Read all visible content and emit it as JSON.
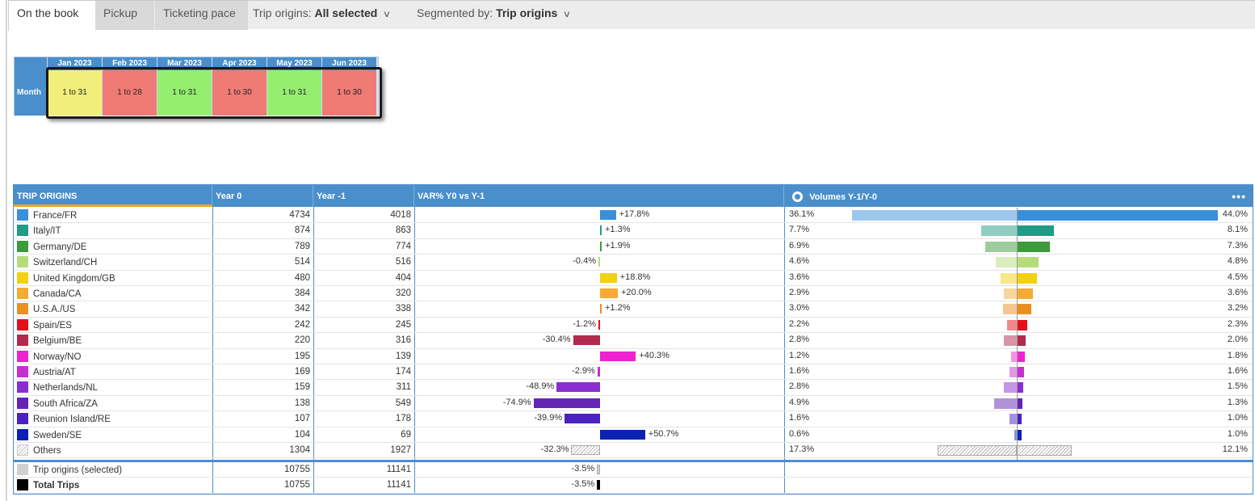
{
  "tabs": [
    "On the book",
    "Pickup",
    "Ticketing pace"
  ],
  "filters": [
    {
      "label": "Trip origins:",
      "value": "All selected"
    },
    {
      "label": "Segmented by:",
      "value": "Trip origins"
    }
  ],
  "calendar": {
    "row_label": "Month",
    "months": [
      {
        "name": "Jan 2023",
        "range": "1 to 31",
        "status": "yellow"
      },
      {
        "name": "Feb 2023",
        "range": "1 to 28",
        "status": "red"
      },
      {
        "name": "Mar 2023",
        "range": "1 to 31",
        "status": "green"
      },
      {
        "name": "Apr 2023",
        "range": "1 to 30",
        "status": "red"
      },
      {
        "name": "May 2023",
        "range": "1 to 31",
        "status": "green"
      },
      {
        "name": "Jun 2023",
        "range": "1 to 30",
        "status": "red"
      }
    ]
  },
  "table": {
    "headers": {
      "origin": "TRIP ORIGINS",
      "year0": "Year 0",
      "year1": "Year -1",
      "var": "VAR% Y0 vs Y-1",
      "volumes": "Volumes Y-1/Y-0",
      "menu": "•••"
    },
    "rows": [
      {
        "name": "France/FR",
        "color": "#3a8fdc",
        "y0": "4734",
        "y1": "4018",
        "var": 17.8,
        "var_label": "+17.8%",
        "vol_prev": 36.1,
        "vol_prev_label": "36.1%",
        "vol_cur": 44.0,
        "vol_cur_label": "44.0%"
      },
      {
        "name": "Italy/IT",
        "color": "#1f9b86",
        "y0": "874",
        "y1": "863",
        "var": 1.3,
        "var_label": "+1.3%",
        "vol_prev": 7.7,
        "vol_prev_label": "7.7%",
        "vol_cur": 8.1,
        "vol_cur_label": "8.1%"
      },
      {
        "name": "Germany/DE",
        "color": "#3b9b3a",
        "y0": "789",
        "y1": "774",
        "var": 1.9,
        "var_label": "+1.9%",
        "vol_prev": 6.9,
        "vol_prev_label": "6.9%",
        "vol_cur": 7.3,
        "vol_cur_label": "7.3%"
      },
      {
        "name": "Switzerland/CH",
        "color": "#b6dc7a",
        "y0": "514",
        "y1": "516",
        "var": -0.4,
        "var_label": "-0.4%",
        "vol_prev": 4.6,
        "vol_prev_label": "4.6%",
        "vol_cur": 4.8,
        "vol_cur_label": "4.8%"
      },
      {
        "name": "United Kingdom/GB",
        "color": "#f2d20e",
        "y0": "480",
        "y1": "404",
        "var": 18.8,
        "var_label": "+18.8%",
        "vol_prev": 3.6,
        "vol_prev_label": "3.6%",
        "vol_cur": 4.5,
        "vol_cur_label": "4.5%"
      },
      {
        "name": "Canada/CA",
        "color": "#f5ab35",
        "y0": "384",
        "y1": "320",
        "var": 20.0,
        "var_label": "+20.0%",
        "vol_prev": 2.9,
        "vol_prev_label": "2.9%",
        "vol_cur": 3.6,
        "vol_cur_label": "3.6%"
      },
      {
        "name": "U.S.A./US",
        "color": "#ea8f22",
        "y0": "342",
        "y1": "338",
        "var": 1.2,
        "var_label": "+1.2%",
        "vol_prev": 3.0,
        "vol_prev_label": "3.0%",
        "vol_cur": 3.2,
        "vol_cur_label": "3.2%"
      },
      {
        "name": "Spain/ES",
        "color": "#e3101a",
        "y0": "242",
        "y1": "245",
        "var": -1.2,
        "var_label": "-1.2%",
        "vol_prev": 2.2,
        "vol_prev_label": "2.2%",
        "vol_cur": 2.3,
        "vol_cur_label": "2.3%"
      },
      {
        "name": "Belgium/BE",
        "color": "#b12b4e",
        "y0": "220",
        "y1": "316",
        "var": -30.4,
        "var_label": "-30.4%",
        "vol_prev": 2.8,
        "vol_prev_label": "2.8%",
        "vol_cur": 2.0,
        "vol_cur_label": "2.0%"
      },
      {
        "name": "Norway/NO",
        "color": "#ee22d0",
        "y0": "195",
        "y1": "139",
        "var": 40.3,
        "var_label": "+40.3%",
        "vol_prev": 1.2,
        "vol_prev_label": "1.2%",
        "vol_cur": 1.8,
        "vol_cur_label": "1.8%"
      },
      {
        "name": "Austria/AT",
        "color": "#c530cf",
        "y0": "169",
        "y1": "174",
        "var": -2.9,
        "var_label": "-2.9%",
        "vol_prev": 1.6,
        "vol_prev_label": "1.6%",
        "vol_cur": 1.6,
        "vol_cur_label": "1.6%"
      },
      {
        "name": "Netherlands/NL",
        "color": "#8a2ecf",
        "y0": "159",
        "y1": "311",
        "var": -48.9,
        "var_label": "-48.9%",
        "vol_prev": 2.8,
        "vol_prev_label": "2.8%",
        "vol_cur": 1.5,
        "vol_cur_label": "1.5%"
      },
      {
        "name": "South Africa/ZA",
        "color": "#6425b3",
        "y0": "138",
        "y1": "549",
        "var": -74.9,
        "var_label": "-74.9%",
        "vol_prev": 4.9,
        "vol_prev_label": "4.9%",
        "vol_cur": 1.3,
        "vol_cur_label": "1.3%"
      },
      {
        "name": "Reunion Island/RE",
        "color": "#4b22c0",
        "y0": "107",
        "y1": "178",
        "var": -39.9,
        "var_label": "-39.9%",
        "vol_prev": 1.6,
        "vol_prev_label": "1.6%",
        "vol_cur": 1.0,
        "vol_cur_label": "1.0%"
      },
      {
        "name": "Sweden/SE",
        "color": "#0a23b4",
        "y0": "104",
        "y1": "69",
        "var": 50.7,
        "var_label": "+50.7%",
        "vol_prev": 0.6,
        "vol_prev_label": "0.6%",
        "vol_cur": 1.0,
        "vol_cur_label": "1.0%"
      },
      {
        "name": "Others",
        "color": "hatch",
        "y0": "1304",
        "y1": "1927",
        "var": -32.3,
        "var_label": "-32.3%",
        "vol_prev": 17.3,
        "vol_prev_label": "17.3%",
        "vol_cur": 12.1,
        "vol_cur_label": "12.1%"
      }
    ],
    "totals": [
      {
        "name": "Trip origins (selected)",
        "color": "#d0d0d0",
        "y0": "10755",
        "y1": "11141",
        "var": -3.5,
        "var_label": "-3.5%",
        "bold": false
      },
      {
        "name": "Total Trips",
        "color": "#000000",
        "y0": "10755",
        "y1": "11141",
        "var": -3.5,
        "var_label": "-3.5%",
        "bold": true
      }
    ]
  }
}
